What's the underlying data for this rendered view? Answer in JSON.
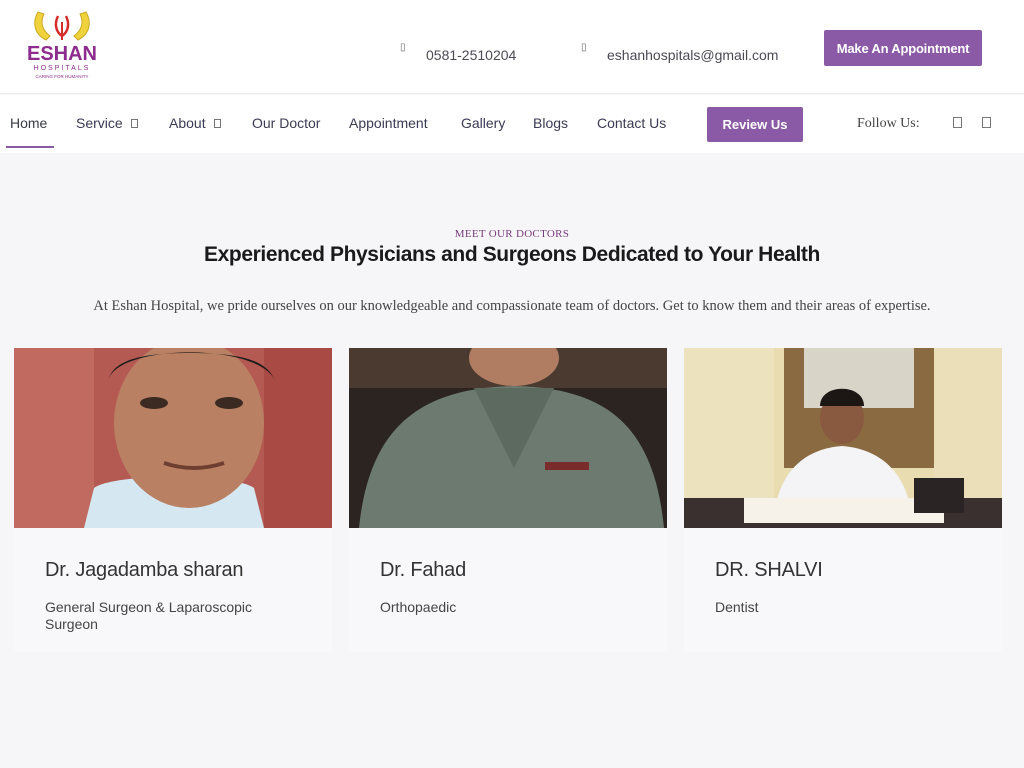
{
  "header": {
    "logo_text": "ESHAN",
    "logo_sub": "HOSPITALS",
    "logo_tagline": "CARING FOR HUMANITY",
    "phone": "0581-2510204",
    "email": "eshanhospitals@gmail.com",
    "appointment_button": "Make An Appointment"
  },
  "nav": {
    "items": [
      {
        "label": "Home"
      },
      {
        "label": "Service"
      },
      {
        "label": "About"
      },
      {
        "label": "Our Doctor"
      },
      {
        "label": "Appointment"
      },
      {
        "label": "Gallery"
      },
      {
        "label": "Blogs"
      },
      {
        "label": "Contact Us"
      }
    ],
    "review_button": "Review Us",
    "follow_label": "Follow Us:"
  },
  "section": {
    "eyebrow": "MEET OUR DOCTORS",
    "heading": "Experienced Physicians and Surgeons Dedicated to Your Health",
    "intro": "At Eshan Hospital, we pride ourselves on our knowledgeable and compassionate team of doctors. Get to know them and their areas of expertise."
  },
  "doctors": [
    {
      "name": "Dr. Jagadamba sharan",
      "specialty": "General Surgeon & Laparoscopic Surgeon"
    },
    {
      "name": "Dr. Fahad",
      "specialty": "Orthopaedic"
    },
    {
      "name": "DR. SHALVI",
      "specialty": "Dentist"
    }
  ],
  "colors": {
    "accent": "#8b5aa6",
    "eyebrow": "#7a3b7f",
    "background": "#f6f6f8"
  }
}
